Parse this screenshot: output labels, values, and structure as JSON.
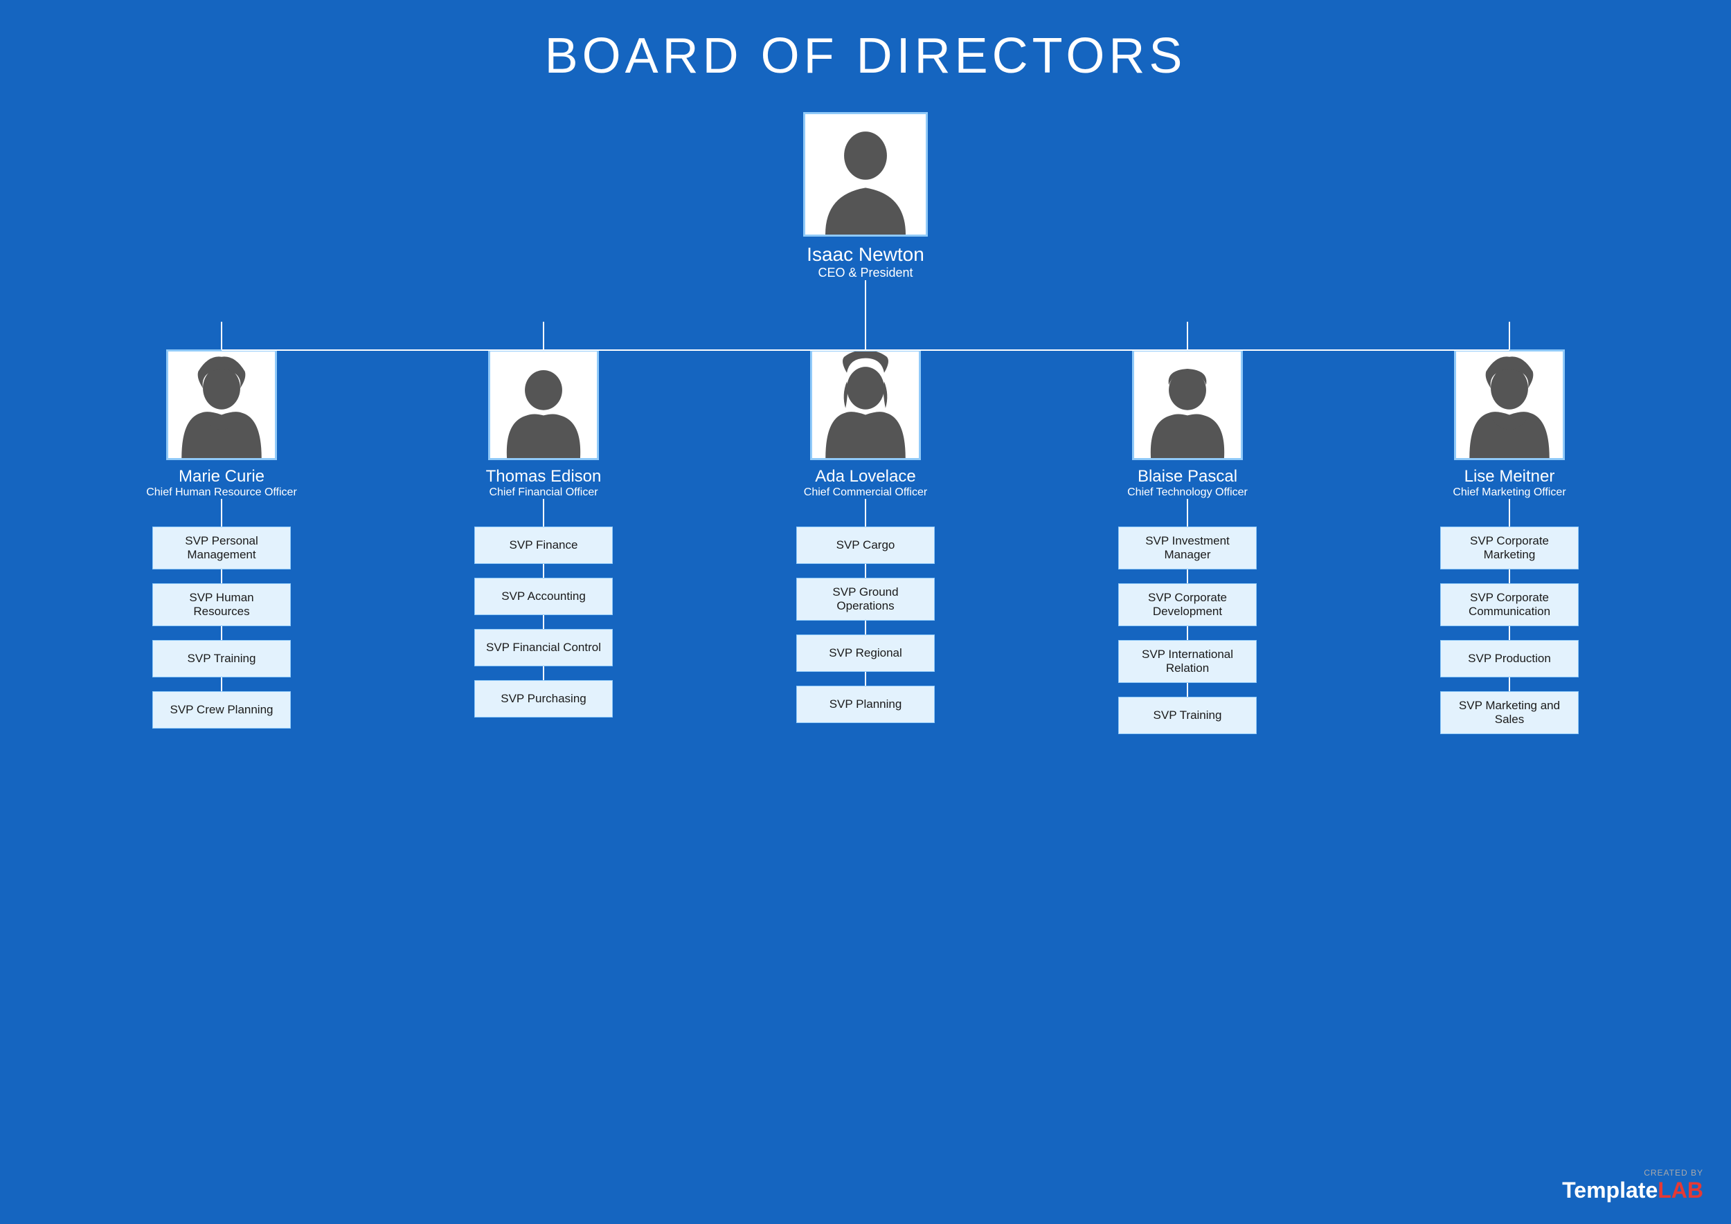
{
  "page": {
    "title": "BOARD OF DIRECTORS",
    "background_color": "#1565C0"
  },
  "ceo": {
    "name": "Isaac Newton",
    "title": "CEO & President"
  },
  "directors": [
    {
      "id": "marie-curie",
      "name": "Marie Curie",
      "title": "Chief Human Resource Officer",
      "gender": "female",
      "svp_items": [
        "SVP Personal Management",
        "SVP Human Resources",
        "SVP Training",
        "SVP Crew Planning"
      ]
    },
    {
      "id": "thomas-edison",
      "name": "Thomas Edison",
      "title": "Chief Financial Officer",
      "gender": "male",
      "svp_items": [
        "SVP Finance",
        "SVP Accounting",
        "SVP Financial Control",
        "SVP Purchasing"
      ]
    },
    {
      "id": "ada-lovelace",
      "name": "Ada Lovelace",
      "title": "Chief Commercial Officer",
      "gender": "female2",
      "svp_items": [
        "SVP Cargo",
        "SVP Ground Operations",
        "SVP Regional",
        "SVP Planning"
      ]
    },
    {
      "id": "blaise-pascal",
      "name": "Blaise Pascal",
      "title": "Chief Technology Officer",
      "gender": "male2",
      "svp_items": [
        "SVP Investment Manager",
        "SVP Corporate Development",
        "SVP International Relation",
        "SVP Training"
      ]
    },
    {
      "id": "lise-meitner",
      "name": "Lise Meitner",
      "title": "Chief Marketing Officer",
      "gender": "female",
      "svp_items": [
        "SVP Corporate Marketing",
        "SVP Corporate Communication",
        "SVP Production",
        "SVP Marketing and Sales"
      ]
    }
  ],
  "watermark": {
    "created_by": "CREATED BY",
    "template_text": "Template",
    "lab_text": "LAB"
  }
}
